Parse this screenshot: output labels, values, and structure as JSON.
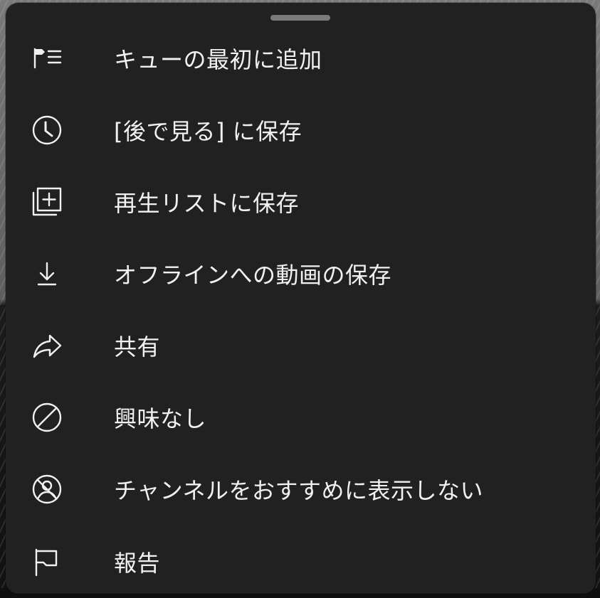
{
  "menu": {
    "items": [
      {
        "label": "キューの最初に追加",
        "icon": "play-next-queue-icon"
      },
      {
        "label": "[後で見る] に保存",
        "icon": "clock-icon"
      },
      {
        "label": "再生リストに保存",
        "icon": "add-to-playlist-icon"
      },
      {
        "label": "オフラインへの動画の保存",
        "icon": "download-icon"
      },
      {
        "label": "共有",
        "icon": "share-icon"
      },
      {
        "label": "興味なし",
        "icon": "not-interested-icon"
      },
      {
        "label": "チャンネルをおすすめに表示しない",
        "icon": "block-channel-icon"
      },
      {
        "label": "報告",
        "icon": "flag-icon"
      }
    ]
  },
  "colors": {
    "sheet_background": "#212121",
    "text": "#f1f1f1",
    "drag_handle": "#7a7a7a"
  }
}
